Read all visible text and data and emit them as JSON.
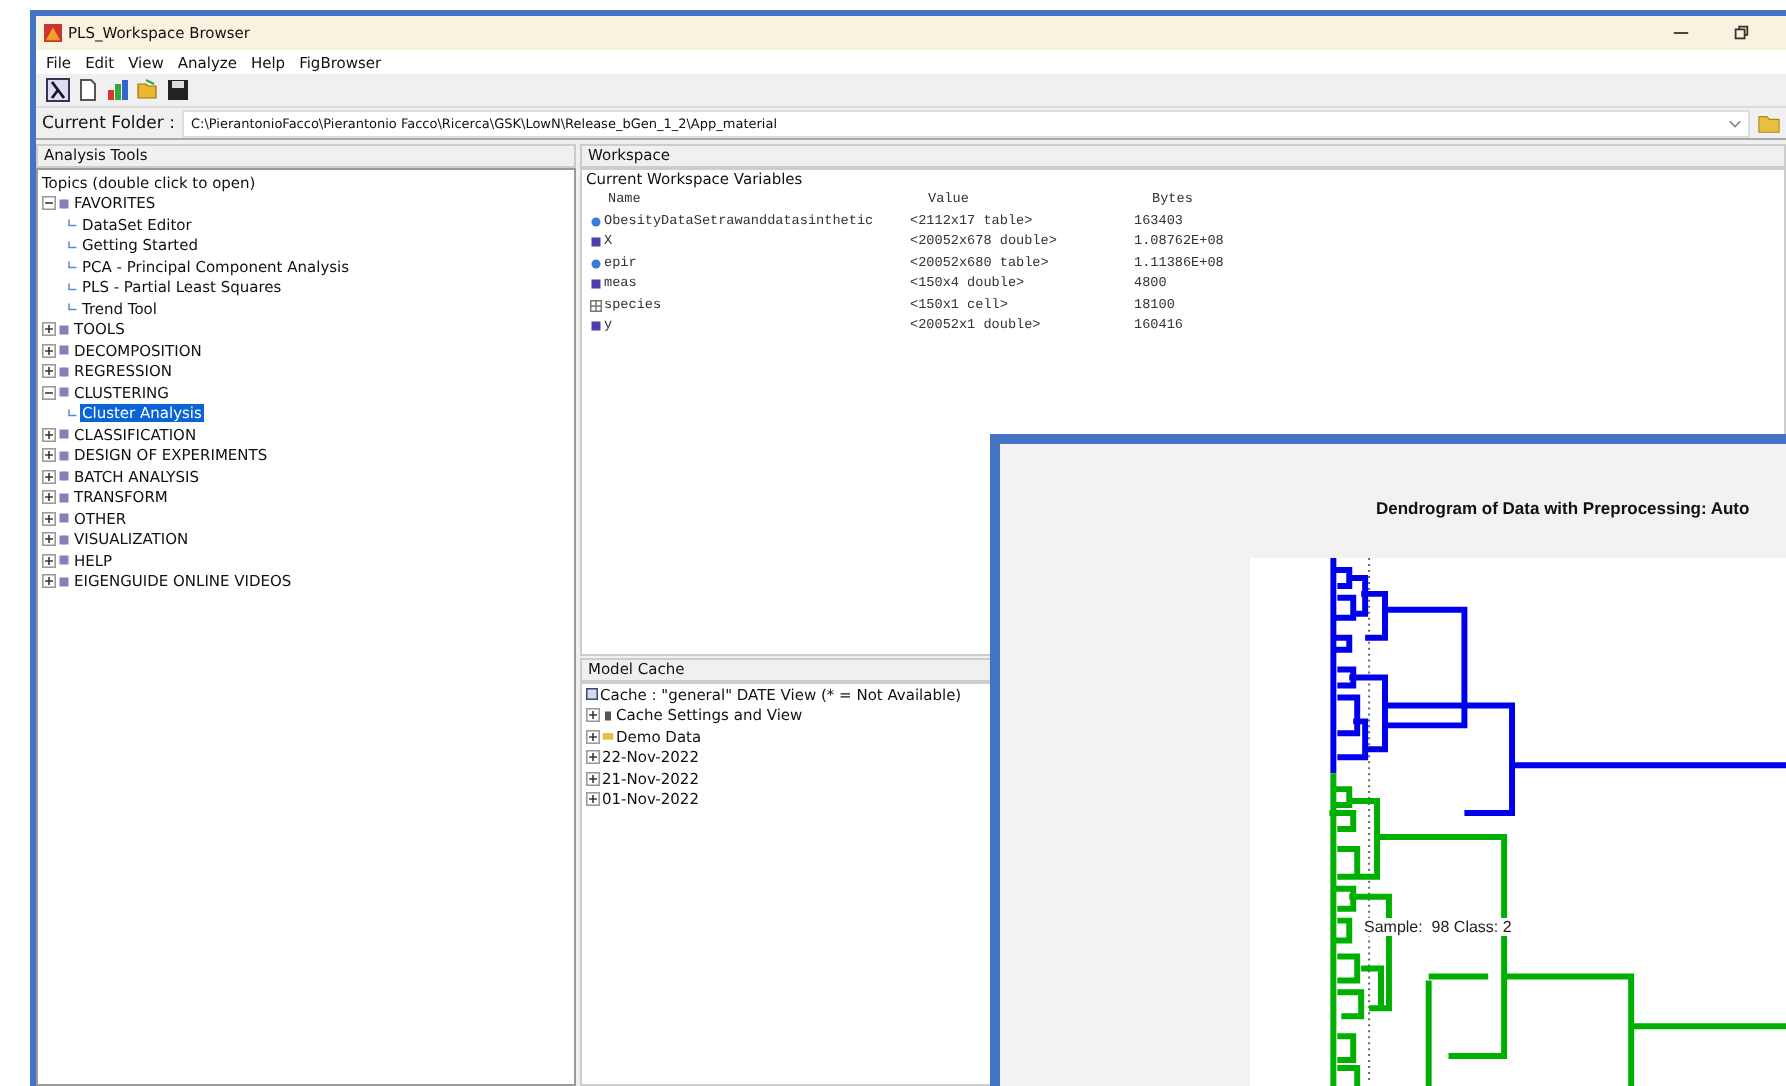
{
  "window": {
    "title": "PLS_Workspace Browser"
  },
  "menu": [
    "File",
    "Edit",
    "View",
    "Analyze",
    "Help",
    "FigBrowser"
  ],
  "current_folder": {
    "label": "Current Folder :",
    "path": "C:\\PierantonioFacco\\Pierantonio Facco\\Ricerca\\GSK\\LowN\\Release_bGen_1_2\\App_material"
  },
  "analysis_tools": {
    "title": "Analysis Tools",
    "header": "Topics (double click to open)",
    "tree": [
      {
        "label": "FAVORITES",
        "expanded": true,
        "selected": false,
        "children": [
          {
            "label": "DataSet Editor",
            "selected": false
          },
          {
            "label": "Getting Started",
            "selected": false
          },
          {
            "label": "PCA - Principal Component Analysis",
            "selected": false
          },
          {
            "label": "PLS - Partial Least Squares",
            "selected": false
          },
          {
            "label": "Trend Tool",
            "selected": false
          }
        ]
      },
      {
        "label": "TOOLS",
        "expanded": false,
        "selected": false
      },
      {
        "label": "DECOMPOSITION",
        "expanded": false,
        "selected": false
      },
      {
        "label": "REGRESSION",
        "expanded": false,
        "selected": false
      },
      {
        "label": "CLUSTERING",
        "expanded": true,
        "selected": false,
        "children": [
          {
            "label": "Cluster Analysis",
            "selected": true
          }
        ]
      },
      {
        "label": "CLASSIFICATION",
        "expanded": false,
        "selected": false
      },
      {
        "label": "DESIGN OF EXPERIMENTS",
        "expanded": false,
        "selected": false
      },
      {
        "label": "BATCH ANALYSIS",
        "expanded": false,
        "selected": false
      },
      {
        "label": "TRANSFORM",
        "expanded": false,
        "selected": false
      },
      {
        "label": "OTHER",
        "expanded": false,
        "selected": false
      },
      {
        "label": "VISUALIZATION",
        "expanded": false,
        "selected": false
      },
      {
        "label": "HELP",
        "expanded": false,
        "selected": false
      },
      {
        "label": "EIGENGUIDE ONLINE VIDEOS",
        "expanded": false,
        "selected": false
      }
    ]
  },
  "workspace": {
    "title": "Workspace",
    "subtitle": "Current Workspace Variables",
    "columns": [
      "Name",
      "Value",
      "Bytes"
    ],
    "rows": [
      {
        "kind": "table",
        "name": "ObesityDataSetrawanddatasinthetic",
        "value": "<2112x17 table>",
        "bytes": "163403"
      },
      {
        "kind": "double",
        "name": "X",
        "value": "<20052x678 double>",
        "bytes": "1.08762E+08"
      },
      {
        "kind": "table",
        "name": "epir",
        "value": "<20052x680 table>",
        "bytes": "1.11386E+08"
      },
      {
        "kind": "double",
        "name": "meas",
        "value": "<150x4 double>",
        "bytes": "4800"
      },
      {
        "kind": "cell",
        "name": "species",
        "value": "<150x1 cell>",
        "bytes": "18100"
      },
      {
        "kind": "double",
        "name": "y",
        "value": "<20052x1 double>",
        "bytes": "160416"
      }
    ]
  },
  "model_cache": {
    "title": "Model Cache",
    "items": [
      {
        "kind": "root",
        "label": "Cache : \"general\" DATE View (* = Not Available)"
      },
      {
        "kind": "settings",
        "label": "Cache Settings and View"
      },
      {
        "kind": "folder",
        "label": "Demo Data"
      },
      {
        "kind": "date",
        "label": "22-Nov-2022"
      },
      {
        "kind": "date",
        "label": "21-Nov-2022"
      },
      {
        "kind": "date",
        "label": "01-Nov-2022"
      }
    ]
  },
  "figure": {
    "title": "Dendrogram of Data with Preprocessing: Auto",
    "annotation": "Sample:  98 Class: 2"
  }
}
